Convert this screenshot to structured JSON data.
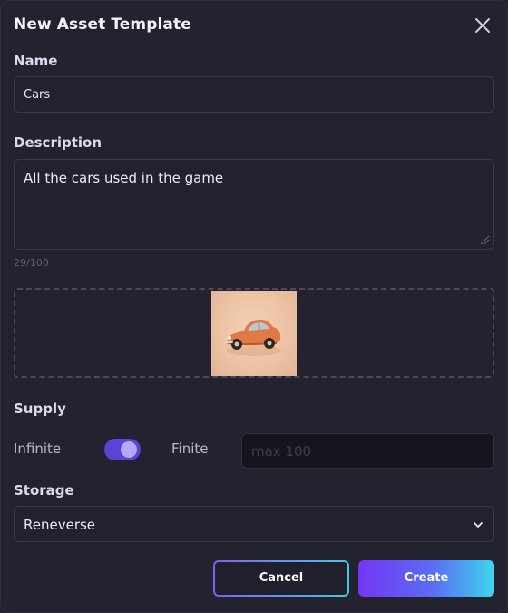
{
  "dialog": {
    "title": "New Asset Template"
  },
  "name_field": {
    "label": "Name",
    "value": "Cars"
  },
  "description_field": {
    "label": "Description",
    "value": "All the cars used in the game",
    "counter": "29/100"
  },
  "image_upload": {
    "thumbnail_icon": "car-image"
  },
  "supply": {
    "label": "Supply",
    "left_option": "Infinite",
    "right_option": "Finite",
    "toggle_on": true,
    "max_placeholder": "max 100",
    "max_value": ""
  },
  "storage": {
    "label": "Storage",
    "selected": "Reneverse"
  },
  "actions": {
    "cancel_label": "Cancel",
    "create_label": "Create"
  },
  "colors": {
    "background": "#23222f",
    "accent_purple": "#5b43d6",
    "gradient_start": "#7436f4",
    "gradient_end": "#3ed6ee"
  }
}
